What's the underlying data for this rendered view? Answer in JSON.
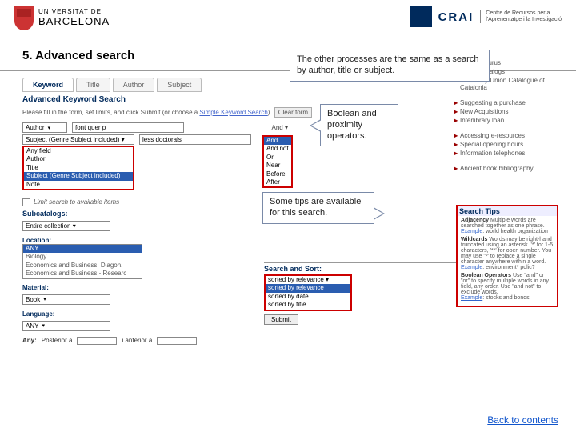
{
  "header": {
    "left": {
      "line1": "UNIVERSITAT DE",
      "line2": "BARCELONA"
    },
    "right": {
      "acronym": "CRAI",
      "sub1": "Centre de Recursos per a",
      "sub2": "l'Aprenentatge i la Investigació"
    }
  },
  "section_title": "5. Advanced search",
  "tabs": [
    "Keyword",
    "Title",
    "Author",
    "Subject"
  ],
  "adv_title": "Advanced Keyword Search",
  "instruct_prefix": "Please fill in the form, set limits, and click Submit (or choose a ",
  "instruct_link": "Simple Keyword Search",
  "instruct_suffix": ")",
  "clear_label": "Clear form",
  "row1": {
    "field": "Author",
    "field_caret": "▾",
    "value": "font quer p",
    "and": "And",
    "and_caret": "▾"
  },
  "dropdown1": {
    "items": [
      "Any field",
      "Author",
      "Title",
      "Subject (Genre Subject included)",
      "Note"
    ],
    "highlight_index": 3,
    "label_above": "Subject (Genre Subject included) ▾",
    "value_right": "less doctorals"
  },
  "dropdown2": {
    "items": [
      "And",
      "And not",
      "Or",
      "Near",
      "Before",
      "After"
    ],
    "highlight_index": 0
  },
  "limit_row": "Limit search to available items",
  "subcatalogs_label": "Subcatalogs:",
  "subcatalogs_sel": "Entire collection    ▾",
  "location_label": "Location:",
  "location_items": [
    "ANY",
    "Biology",
    "Economics and Business. Diagon.",
    "Economics and Business - Researc"
  ],
  "material_label": "Material:",
  "material_sel": "Book",
  "language_label": "Language:",
  "language_sel": "ANY",
  "year": {
    "label": "Any:",
    "after_lbl": "Posterior a",
    "before_lbl": "i anterior a"
  },
  "sort": {
    "title": "Search and Sort:",
    "items": [
      "sorted by relevance ▾",
      "sorted by relevance",
      "sorted by date",
      "sorted by title"
    ],
    "submit": "Submit"
  },
  "rightcol": {
    "group1": [
      "UB Thesaurus",
      "Others catalogs",
      "University Union Catalogue of Catalonia"
    ],
    "group2": [
      "Suggesting a purchase",
      "New Acquisitions",
      "Interlibrary loan"
    ],
    "group3": [
      "Accessing e-resources",
      "Special opening hours",
      "Information telephones"
    ],
    "group4": [
      "Ancient book bibliography"
    ]
  },
  "tips": {
    "title": "Search Tips",
    "rows": [
      {
        "term": "Adjacency",
        "body": "Multiple words are searched together as one phrase.",
        "ex": "Example",
        "ex_body": ": world health organization"
      },
      {
        "term": "Wildcards",
        "body": "Words may be right-hand truncated using an asterisk. '*' for 1-5 characters, '**' for open number. You may use '?' to replace a single character anywhere within a word.",
        "ex": "Example",
        "ex_body": ": environment* polic?"
      },
      {
        "term": "Boolean Operators",
        "body": "Use \"and\" or \"or\" to specify multiple words in any field, any order. Use \"and not\" to exclude words.",
        "ex": "Example",
        "ex_body": ": stocks and bonds"
      }
    ]
  },
  "callouts": {
    "c1": "The other processes are the same as a search by author, title or subject.",
    "c2": "Boolean and proximity operators.",
    "c3": "Some tips are available for this search."
  },
  "footer_link": "Back to contents"
}
